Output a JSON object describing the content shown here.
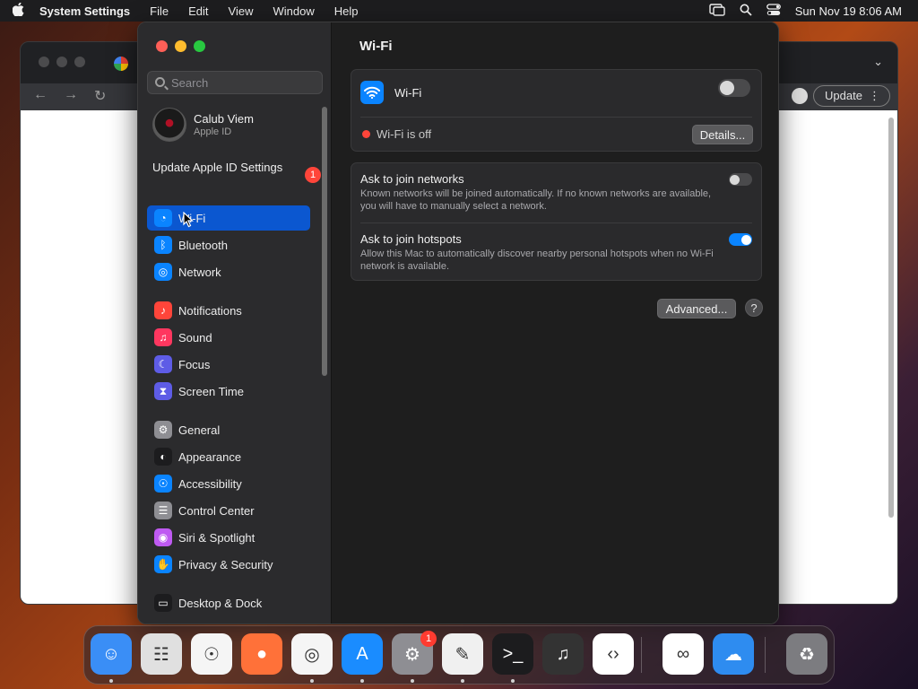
{
  "menubar": {
    "app_name": "System Settings",
    "menus": [
      "File",
      "Edit",
      "View",
      "Window",
      "Help"
    ],
    "datetime": "Sun Nov 19  8:06 AM"
  },
  "browser": {
    "update_label": "Update"
  },
  "settings": {
    "search_placeholder": "Search",
    "profile": {
      "name": "Calub Viem",
      "subtitle": "Apple ID"
    },
    "update_apple_id": {
      "label": "Update Apple ID Settings",
      "badge": "1"
    },
    "nav_items": [
      {
        "label": "Wi-Fi",
        "icon": "wifi-icon",
        "color": "#0a84ff"
      },
      {
        "label": "Bluetooth",
        "icon": "bluetooth-icon",
        "color": "#0a84ff"
      },
      {
        "label": "Network",
        "icon": "globe-icon",
        "color": "#0a84ff"
      },
      {
        "label": "Notifications",
        "icon": "bell-icon",
        "color": "#ff453a"
      },
      {
        "label": "Sound",
        "icon": "speaker-icon",
        "color": "#ff375f"
      },
      {
        "label": "Focus",
        "icon": "moon-icon",
        "color": "#5e5ce6"
      },
      {
        "label": "Screen Time",
        "icon": "hourglass-icon",
        "color": "#5e5ce6"
      },
      {
        "label": "General",
        "icon": "gear-icon",
        "color": "#8e8e93"
      },
      {
        "label": "Appearance",
        "icon": "appearance-icon",
        "color": "#1c1c1e"
      },
      {
        "label": "Accessibility",
        "icon": "accessibility-icon",
        "color": "#0a84ff"
      },
      {
        "label": "Control Center",
        "icon": "control-center-icon",
        "color": "#8e8e93"
      },
      {
        "label": "Siri & Spotlight",
        "icon": "siri-icon",
        "color": "#bf5af2"
      },
      {
        "label": "Privacy & Security",
        "icon": "hand-icon",
        "color": "#0a84ff"
      },
      {
        "label": "Desktop & Dock",
        "icon": "dock-icon",
        "color": "#1c1c1e"
      }
    ],
    "pane": {
      "title": "Wi-Fi",
      "wifi_label": "Wi-Fi",
      "wifi_enabled": false,
      "status_text": "Wi-Fi is off",
      "details_label": "Details...",
      "ask_networks_title": "Ask to join networks",
      "ask_networks_desc": "Known networks will be joined automatically. If no known networks are available, you will have to manually select a network.",
      "ask_networks_enabled": false,
      "ask_hotspots_title": "Ask to join hotspots",
      "ask_hotspots_desc": "Allow this Mac to automatically discover nearby personal hotspots when no Wi-Fi network is available.",
      "ask_hotspots_enabled": true,
      "advanced_label": "Advanced...",
      "help_label": "?"
    }
  },
  "dock": {
    "apps": [
      {
        "name": "finder-icon",
        "color": "#3a8ef6"
      },
      {
        "name": "launchpad-icon",
        "color": "#e0e0e0"
      },
      {
        "name": "safari-icon",
        "color": "#f5f5f5"
      },
      {
        "name": "firefox-icon",
        "color": "#ff7139"
      },
      {
        "name": "chrome-icon",
        "color": "#f5f5f5"
      },
      {
        "name": "app-store-icon",
        "color": "#1a8cff"
      },
      {
        "name": "system-settings-icon",
        "color": "#8e8e93"
      },
      {
        "name": "textedit-icon",
        "color": "#f0f0f0"
      },
      {
        "name": "terminal-icon",
        "color": "#1c1c1e"
      },
      {
        "name": "garageband-icon",
        "color": "#333333"
      },
      {
        "name": "vscode-icon",
        "color": "#ffffff"
      },
      {
        "name": "visual-studio-icon",
        "color": "#ffffff"
      },
      {
        "name": "weather-icon",
        "color": "#2e8cf0"
      },
      {
        "name": "trash-icon",
        "color": "#7c7c80"
      }
    ],
    "settings_badge": "1"
  }
}
